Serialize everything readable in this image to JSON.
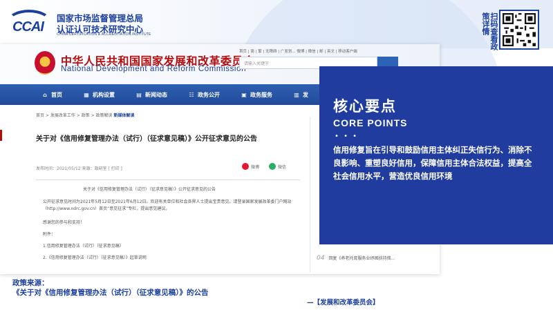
{
  "header": {
    "org_name_line1": "国家市场监督管理总局",
    "org_name_line2": "认证认可技术研究中心",
    "org_name_en": "CHINA CERTIFICATION & ACCREDITATION INSTITUTE",
    "logo_text": "CCAI",
    "scan_text": "扫码查看政策详情"
  },
  "screenshot": {
    "site_title_cn": "中华人民共和国国家发展和改革委员会",
    "site_title_en": "National Development and Reform Commission",
    "top_links": "首页 | 简 | 繁 | 无障碍 | 广发划... 微博 | 微信 | 邮 | 英文 | 移动客户端",
    "search_placeholder": "请输入关键字",
    "nav": [
      {
        "label": "首页",
        "icon": "home-icon",
        "glyph": "⌂"
      },
      {
        "label": "机构设置",
        "icon": "org-icon",
        "glyph": "▦"
      },
      {
        "label": "新闻动态",
        "icon": "news-icon",
        "glyph": "▤"
      },
      {
        "label": "政务公开",
        "icon": "open-icon",
        "glyph": "☷"
      },
      {
        "label": "政务服务",
        "icon": "service-icon",
        "glyph": "▣"
      },
      {
        "label": "发",
        "icon": "more-icon",
        "glyph": "▥"
      }
    ],
    "breadcrumb": {
      "text": "首页 > 发展改革工作 > 政策 > 政策解读",
      "active": "新媒体解读"
    },
    "article_title": "关于对《信用修复管理办法（试行）（征求意见稿）》公开征求意见的公告",
    "meta": "发布时间：2021/05/12    来源：政研室    [ 打印 ]",
    "share_weibo": "微博",
    "share_wechat": "微信",
    "body": {
      "inner_title": "关于对《信用修复管理办法（试行）（征求意见稿）》公开征求意见的公告",
      "para1": "公开征求意见时间为2021年5月12日至2021年6月12日。欢迎有关单位和社会各界人士提出宝贵意见。请登录国家发展改革委门户网站（http://www.ndrc.gov.cn）首页“意见征求”专栏，提出意见建议。",
      "para2": "感谢您的参与和支持！",
      "attach_label": "附件：",
      "attach1": "1.信用修复管理办法（试行）（征求意见稿）",
      "attach2": "2.《信用修复管理办法（试行）（征求意见稿）》起草说明"
    },
    "side_item": {
      "num": "04",
      "text": "回复《养老托育服务业纾困扶持措..."
    }
  },
  "card": {
    "title": "核心要点",
    "title_en": "CORE POINTS",
    "text": "信用修复旨在引导和鼓励信用主体纠正失信行为、消除不良影响、重塑良好信用，保障信用主体合法权益，提高全社会信用水平，营造优良信用环境"
  },
  "footer": {
    "source_label": "政策来源：",
    "source_title": "《关于对《信用修复管理办法（试行）（征求意见稿）》的公告",
    "credit": "—【发展和改革委员会】"
  }
}
